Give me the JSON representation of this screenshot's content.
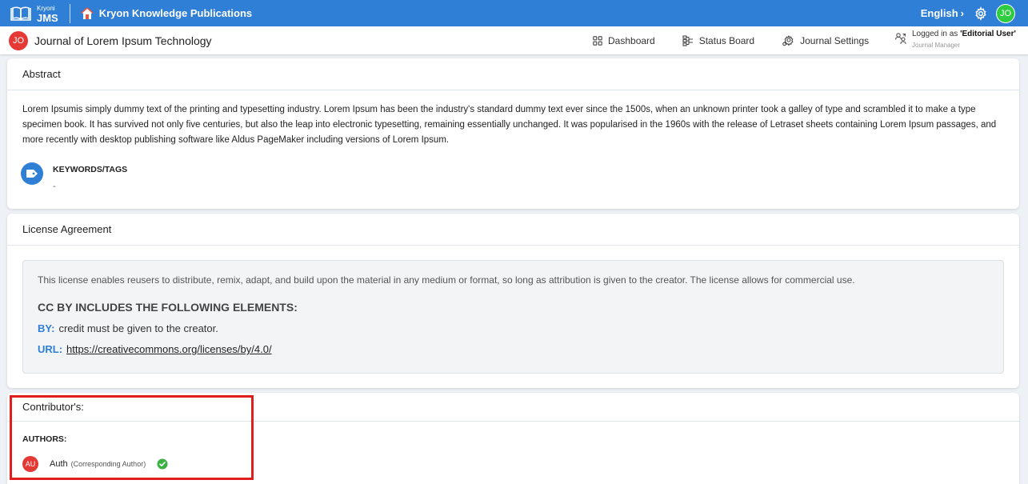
{
  "topbar": {
    "brand_small": "Kryoni",
    "brand_big": "JMS",
    "app_title": "Kryon Knowledge Publications",
    "language": "English",
    "user_initials": "JO"
  },
  "journal": {
    "initials": "JO",
    "title": "Journal of Lorem Ipsum Technology",
    "nav": {
      "dashboard": "Dashboard",
      "status_board": "Status Board",
      "journal_settings": "Journal Settings"
    },
    "logged_in_prefix": "Logged in as ",
    "logged_in_user": "'Editorial User'",
    "role": "Journal Manager"
  },
  "abstract": {
    "heading": "Abstract",
    "text": "Lorem Ipsumis simply dummy text of the printing and typesetting industry. Lorem Ipsum has been the industry's standard dummy text ever since the 1500s, when an unknown printer took a galley of type and scrambled it to make a type specimen book. It has survived not only five centuries, but also the leap into electronic typesetting, remaining essentially unchanged. It was popularised in the 1960s with the release of Letraset sheets containing Lorem Ipsum passages, and more recently with desktop publishing software like Aldus PageMaker including versions of Lorem Ipsum.",
    "keywords_label": "KEYWORDS/TAGS",
    "keywords_value": "-"
  },
  "license": {
    "heading": "License Agreement",
    "description": "This license enables reusers to distribute, remix, adapt, and build upon the material in any medium or format, so long as attribution is given to the creator. The license allows for commercial use.",
    "elements_heading": "CC BY INCLUDES THE FOLLOWING ELEMENTS:",
    "by_key": "BY:",
    "by_text": "credit must be given to the creator.",
    "url_key": "URL:",
    "url": "https://creativecommons.org/licenses/by/4.0/"
  },
  "contributors": {
    "heading": "Contributor's:",
    "authors_label": "AUTHORS:",
    "authors": [
      {
        "initials": "AU",
        "name": "Auth",
        "role": "(Corresponding Author)"
      }
    ]
  },
  "colors": {
    "primary": "#2f7fd6",
    "avatar_red": "#e53935",
    "user_green": "#2ecc40",
    "highlight": "#e01e1e",
    "check_green": "#3cb043"
  },
  "icons": [
    "home-icon",
    "gear-icon",
    "dashboard-icon",
    "status-board-icon",
    "journal-settings-icon",
    "user-switch-icon",
    "tag-icon",
    "check-icon",
    "chevron-right-icon",
    "book-logo-icon"
  ]
}
